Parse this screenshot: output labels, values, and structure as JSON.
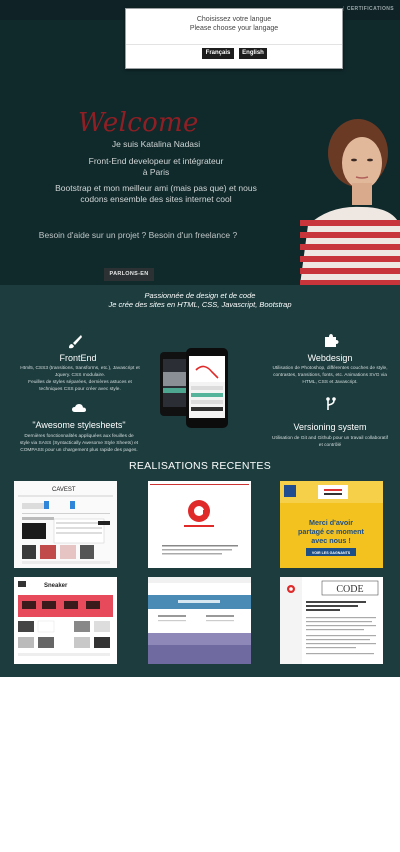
{
  "nav": {
    "certifications": "CERTIFICATIONS"
  },
  "modal": {
    "line1": "Choisissez votre langue",
    "line2": "Please choose your langage",
    "btn_fr": "Français",
    "btn_en": "English"
  },
  "hero": {
    "welcome": "Welcome",
    "line1": "Je suis Katalina Nadasi",
    "line2": "Front-End developeur et intégrateur",
    "line3": "à Paris",
    "line4": "Bootstrap et mon meilleur ami (mais pas que) et nous",
    "line5": "codons ensemble des sites internet cool",
    "help": "Besoin d'aide sur un projet ? Besoin d'un freelance ?",
    "cta": "PARLONS-EN"
  },
  "skills": {
    "intro1": "Passionnée de design et de code",
    "intro2": "Je crée des sites en HTML, CSS, Javascript, Bootstrap",
    "frontend": {
      "title": "FrontEnd",
      "desc1": "Html5, CSS3 (transitions, transforms, etc.), Javascript et",
      "desc2": "Jquery. CSS modulaire.",
      "desc3": "Feuilles de styles séparées, dernières astuces et",
      "desc4": "techniques CSS pour créer avec style."
    },
    "awesome": {
      "title": "\"Awesome stylesheets\"",
      "desc1": "Dernières fonctionnalités appliquées aux feuilles de",
      "desc2": "style via SASS (Syntactically Awesome Style Sheets) et",
      "desc3": "COMPASS pour un chargement plus rapide des pages."
    },
    "webdesign": {
      "title": "Webdesign",
      "desc1": "Utilisation de Photoshop, différentes couches de style,",
      "desc2": "contrastes, transitions, fonts, etc. Animations SVG via",
      "desc3": "HTML, CSS et Javascript."
    },
    "versioning": {
      "title": "Versioning system",
      "desc1": "Utilisation de Git and Github pour un travail collaboratif",
      "desc2": "et contrôlé"
    },
    "realisations_title": "REALISATIONS RECENTES"
  },
  "thumbs": {
    "t1_brand": "CAVEST",
    "t3_line1": "Merci d'avoir",
    "t3_line2": "partagé ce moment",
    "t3_line3": "avec nous !",
    "t3_btn": "VOIR LES GAGNANTS",
    "t4_brand": "Sneaker",
    "t6_code": "CODE"
  },
  "colors": {
    "hero_bg": "#10292b",
    "skills_bg": "#1c3c3e",
    "welcome": "#8f1f24",
    "accent_red": "#e02a2a",
    "yellow": "#f4c21e"
  }
}
